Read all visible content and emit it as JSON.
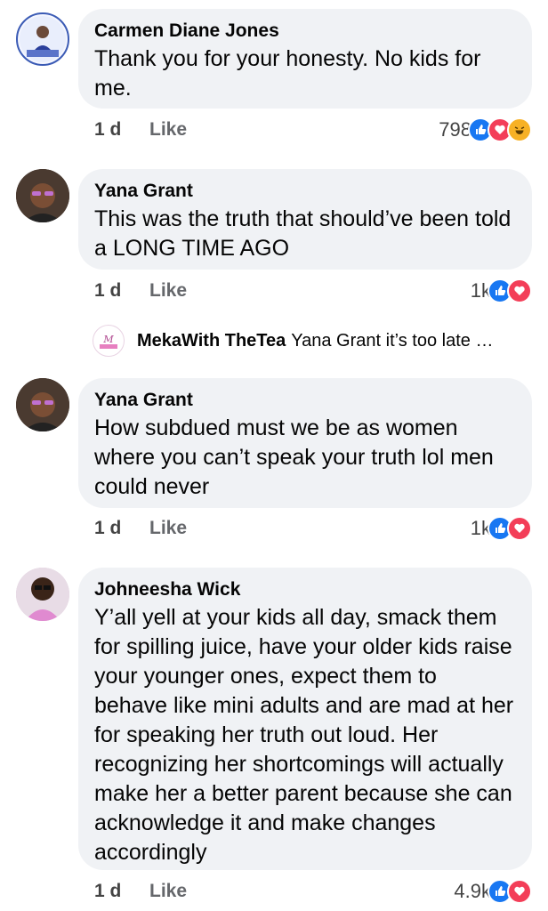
{
  "comments": [
    {
      "author": "Carmen Diane Jones",
      "text": "Thank you for your honesty. No kids for me.",
      "time": "1 d",
      "like": "Like",
      "reaction_count": "798",
      "reactions": [
        "like-reaction-icon",
        "love-reaction-icon",
        "haha-reaction-icon"
      ]
    },
    {
      "author": "Yana Grant",
      "text": "This was the truth that should’ve been told a LONG TIME AGO",
      "time": "1 d",
      "like": "Like",
      "reaction_count": "1k",
      "reactions": [
        "like-reaction-icon",
        "love-reaction-icon"
      ],
      "reply": {
        "author": "MekaWith TheTea",
        "text": "Yana Grant it’s too late t…"
      }
    },
    {
      "author": "Yana Grant",
      "text": "How subdued must we be as women where you can’t speak your truth lol men could never",
      "time": "1 d",
      "like": "Like",
      "reaction_count": "1k",
      "reactions": [
        "like-reaction-icon",
        "love-reaction-icon"
      ]
    },
    {
      "author": "Johneesha Wick",
      "text": "Y’all yell at your kids all day, smack them for spilling juice, have your older kids raise your younger ones, expect them to behave like mini adults and are mad at her for speaking her truth out loud. Her recognizing her shortcomings will actually make her a better parent because she can acknowledge it and make changes accordingly",
      "time": "1 d",
      "like": "Like",
      "reaction_count": "4.9k",
      "reactions": [
        "like-reaction-icon",
        "love-reaction-icon"
      ]
    }
  ],
  "colors": {
    "bubble": "#f0f2f5",
    "like": "#1877f2",
    "love": "#f33e58",
    "haha": "#f7b125",
    "meta_text": "#65676b"
  }
}
